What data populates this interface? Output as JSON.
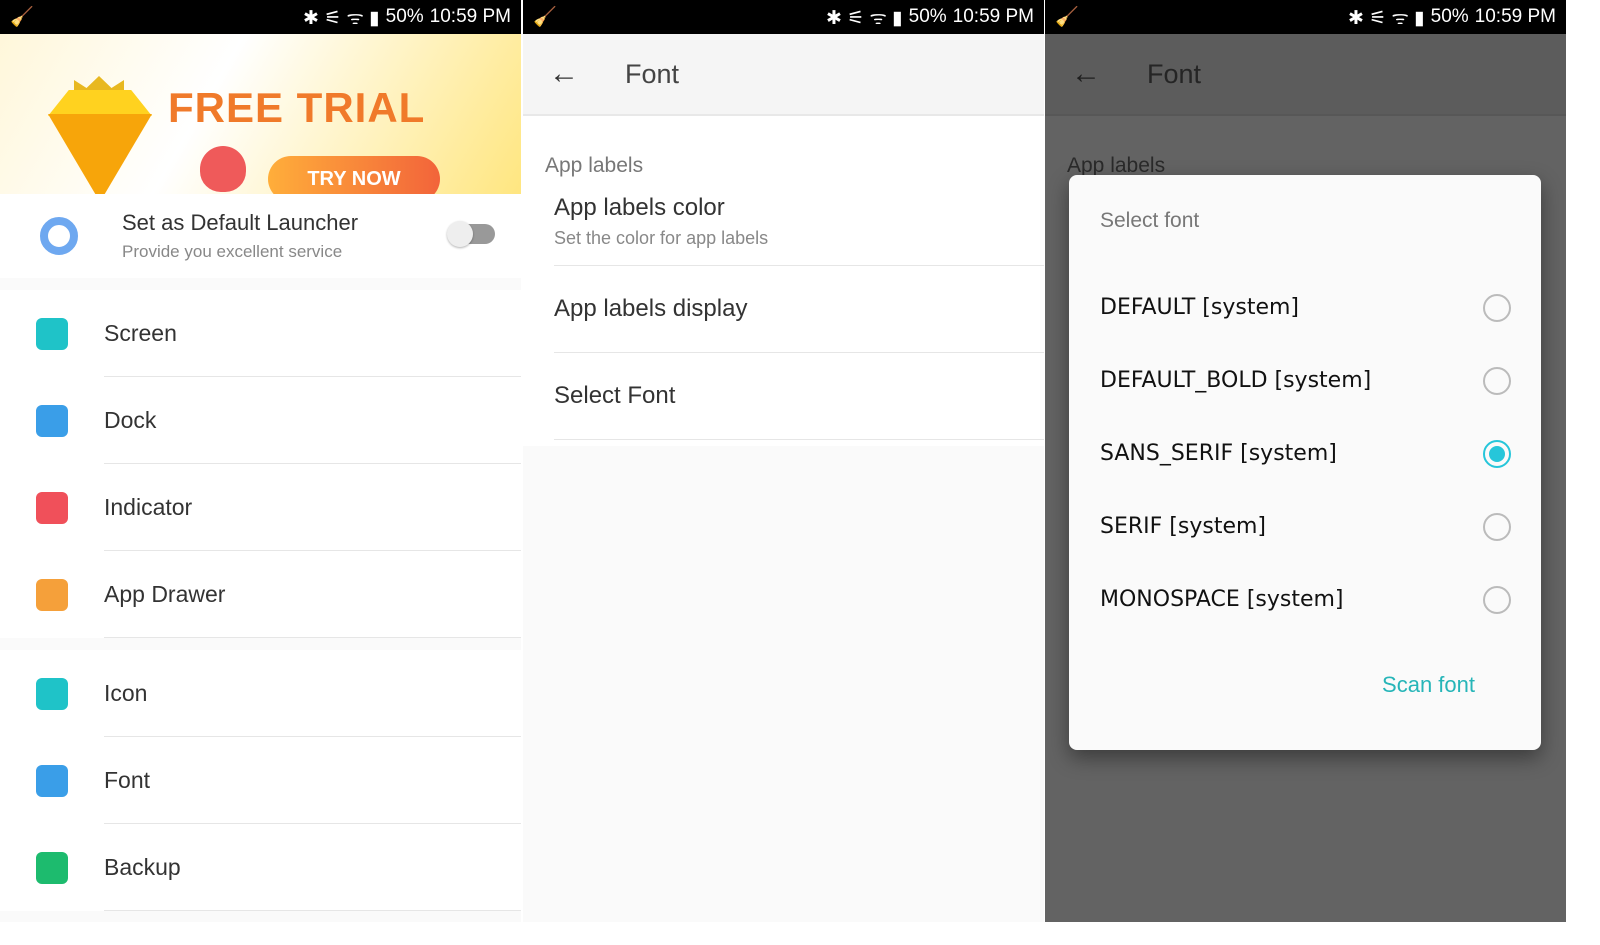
{
  "status": {
    "battery": "50%",
    "time": "10:59 PM"
  },
  "p1": {
    "banner": {
      "title": "FREE TRIAL",
      "cta": "TRY NOW"
    },
    "default_launcher": {
      "title": "Set as Default Launcher",
      "subtitle": "Provide you excellent service",
      "enabled": false
    },
    "group1": [
      {
        "label": "Screen",
        "icon": "screen-icon",
        "color": "#1fc3c8"
      },
      {
        "label": "Dock",
        "icon": "dock-icon",
        "color": "#3a9ee8"
      },
      {
        "label": "Indicator",
        "icon": "indicator-icon",
        "color": "#f0505a"
      },
      {
        "label": "App Drawer",
        "icon": "app-drawer-icon",
        "color": "#f5a03a"
      }
    ],
    "group2": [
      {
        "label": "Icon",
        "icon": "icon-icon",
        "color": "#1fc3c8"
      },
      {
        "label": "Font",
        "icon": "font-icon",
        "color": "#3a9ee8"
      },
      {
        "label": "Backup",
        "icon": "backup-icon",
        "color": "#1dbb6e"
      }
    ]
  },
  "p2": {
    "title": "Font",
    "section": "App labels",
    "items": [
      {
        "title": "App labels color",
        "subtitle": "Set the color for app labels"
      },
      {
        "title": "App labels display"
      },
      {
        "title": "Select Font"
      }
    ]
  },
  "p3": {
    "title": "Font",
    "section": "App labels",
    "dialog": {
      "title": "Select font",
      "options": [
        {
          "label": "DEFAULT [system]",
          "selected": false
        },
        {
          "label": "DEFAULT_BOLD [system]",
          "selected": false
        },
        {
          "label": "SANS_SERIF [system]",
          "selected": true
        },
        {
          "label": "SERIF [system]",
          "selected": false
        },
        {
          "label": "MONOSPACE [system]",
          "selected": false
        }
      ],
      "action": "Scan font"
    },
    "accent": "#26c6da"
  }
}
